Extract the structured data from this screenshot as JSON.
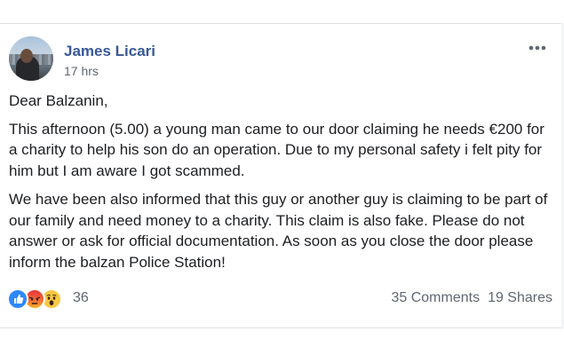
{
  "post": {
    "author": "James Licari",
    "timestamp": "17 hrs",
    "more_icon": "ellipsis-icon",
    "greeting": "Dear Balzanin,",
    "paragraphs": [
      "This afternoon (5.00) a young man came to our door claiming he needs €200 for a charity to help his son do an operation. Due to my personal safety i felt pity for him but I am aware I got scammed.",
      "We have been also informed that this guy or another guy is claiming to be part of our family and need money to a charity. This claim is also fake. Please do not answer or ask for official documentation. As soon as you close the door please inform the balzan Police Station!"
    ]
  },
  "footer": {
    "reactions": [
      "like-icon",
      "angry-icon",
      "wow-icon"
    ],
    "reaction_count": "36",
    "comments": "35 Comments",
    "shares": "19 Shares"
  },
  "colors": {
    "author_link": "#385898",
    "meta_text": "#616770",
    "like_blue": "#2d88ff",
    "angry_red": "#e9353a",
    "wow_yellow": "#f7c843"
  }
}
